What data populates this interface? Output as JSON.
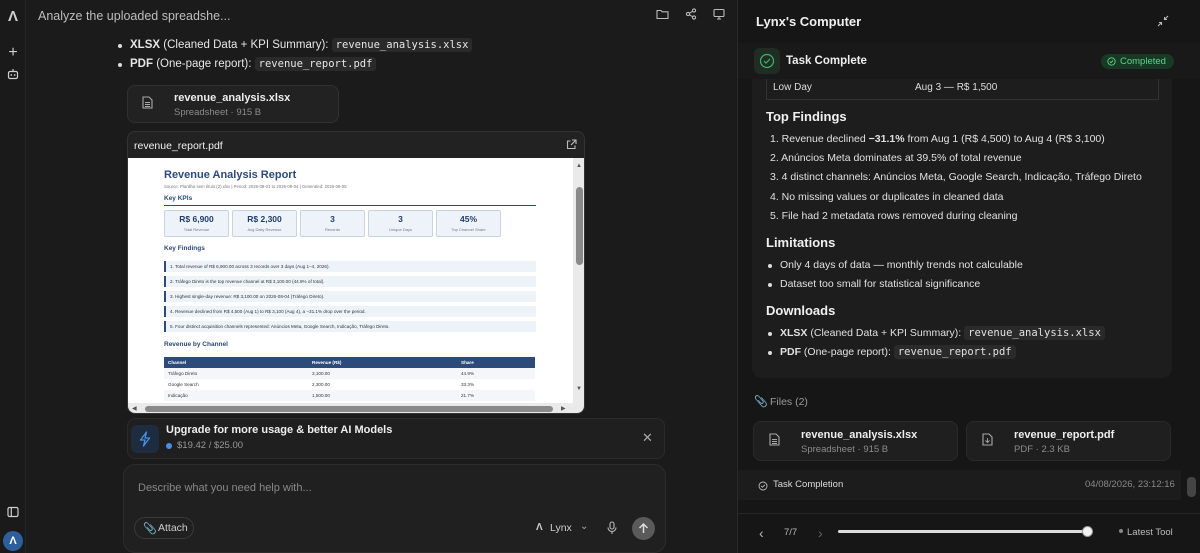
{
  "app": {
    "logo": "Λ"
  },
  "chat": {
    "title": "Analyze the uploaded spreadshe...",
    "bullets": [
      {
        "bold": "XLSX",
        "text": "(Cleaned Data + KPI Summary):",
        "code": "revenue_analysis.xlsx"
      },
      {
        "bold": "PDF",
        "text": "(One-page report):",
        "code": "revenue_report.pdf"
      }
    ],
    "file": {
      "name": "revenue_analysis.xlsx",
      "meta": "Spreadsheet · 915 B"
    },
    "pdf_preview": {
      "filename": "revenue_report.pdf",
      "title": "Revenue Analysis Report",
      "subtitle": "Source: Planilha sem título (2).xlsx | Period: 2026-08-01 to 2026-08-04 | Generated: 2026-08-05",
      "kpis_heading": "Key KPIs",
      "kpis": [
        {
          "value": "R$ 6,900",
          "label": "Total Revenue"
        },
        {
          "value": "R$ 2,300",
          "label": "Avg Daily Revenue"
        },
        {
          "value": "3",
          "label": "Records"
        },
        {
          "value": "3",
          "label": "Unique Days"
        },
        {
          "value": "45%",
          "label": "Top Channel Share"
        }
      ],
      "findings_heading": "Key Findings",
      "findings": [
        "1. Total revenue of R$ 6,900.00 across 3 records over 3 days (Aug 1–4, 2026).",
        "2. Tráfego Direto is the top revenue channel at R$ 3,100.00 (44.9% of total).",
        "3. Highest single-day revenue: R$ 3,100.00 on 2026-08-04 (Tráfego Direto).",
        "4. Revenue declined from R$ 4,500 (Aug 1) to R$ 3,100 (Aug 4), a −31.1% drop over the period.",
        "5. Four distinct acquisition channels represented: Anúncios Meta, Google Search, Indicação, Tráfego Direto."
      ],
      "channel_heading": "Revenue by Channel",
      "table_headers": [
        "Channel",
        "Revenue (R$)",
        "Share"
      ],
      "table_rows": [
        [
          "Tráfego Direto",
          "3,100.00",
          "44.9%"
        ],
        [
          "Google Search",
          "2,300.00",
          "33.3%"
        ],
        [
          "Indicação",
          "1,500.00",
          "21.7%"
        ]
      ]
    },
    "upgrade": {
      "title": "Upgrade for more usage & better AI Models",
      "usage": "$19.42 / $25.00"
    },
    "composer": {
      "placeholder": "Describe what you need help with...",
      "attach": "Attach",
      "model": "Lynx"
    }
  },
  "panel": {
    "title": "Lynx's Computer",
    "task": "Task Complete",
    "status": "Completed",
    "low_day": {
      "label": "Low Day",
      "value": "Aug 3 — R$ 1,500"
    },
    "top_findings_heading": "Top Findings",
    "top_findings": [
      {
        "pre": "1. Revenue declined ",
        "bold": "−31.1%",
        "post": " from Aug 1 (R$ 4,500) to Aug 4 (R$ 3,100)"
      },
      {
        "pre": "2. Anúncios Meta dominates at 39.5% of total revenue",
        "bold": "",
        "post": ""
      },
      {
        "pre": "3. 4 distinct channels: Anúncios Meta, Google Search, Indicação, Tráfego Direto",
        "bold": "",
        "post": ""
      },
      {
        "pre": "4. No missing values or duplicates in cleaned data",
        "bold": "",
        "post": ""
      },
      {
        "pre": "5. File had 2 metadata rows removed during cleaning",
        "bold": "",
        "post": ""
      }
    ],
    "limitations_heading": "Limitations",
    "limitations": [
      "Only 4 days of data — monthly trends not calculable",
      "Dataset too small for statistical significance"
    ],
    "downloads_heading": "Downloads",
    "downloads": [
      {
        "bold": "XLSX",
        "text": "(Cleaned Data + KPI Summary):",
        "code": "revenue_analysis.xlsx"
      },
      {
        "bold": "PDF",
        "text": "(One-page report):",
        "code": "revenue_report.pdf"
      }
    ],
    "files_label": "Files (2)",
    "files": [
      {
        "name": "revenue_analysis.xlsx",
        "meta": "Spreadsheet · 915 B"
      },
      {
        "name": "revenue_report.pdf",
        "meta": "PDF · 2.3 KB"
      }
    ],
    "task_completion": "Task Completion",
    "timestamp": "04/08/2026, 23:12:16",
    "pager": "7/7",
    "progress": 1.0,
    "latest": "Latest Tool"
  }
}
